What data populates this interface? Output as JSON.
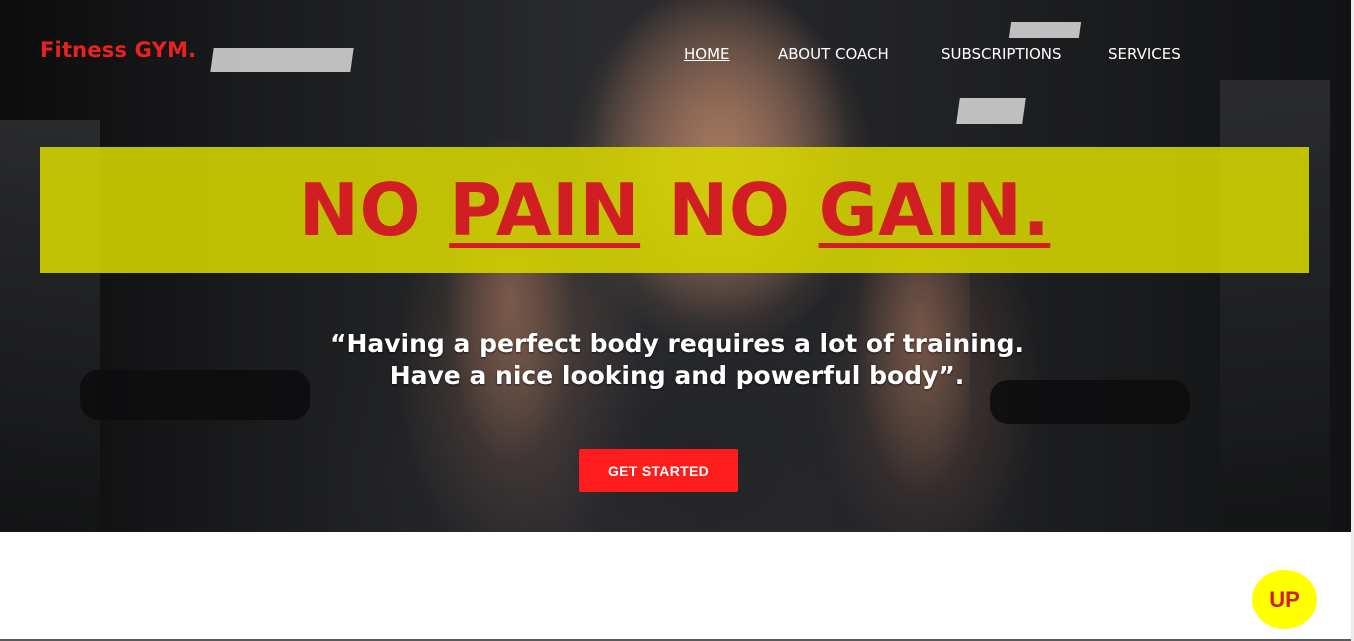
{
  "brand": {
    "logo_text": "Fitness GYM."
  },
  "nav": {
    "items": [
      {
        "label": "HOME",
        "active": true
      },
      {
        "label": "ABOUT COACH",
        "active": false
      },
      {
        "label": "SUBSCRIPTIONS",
        "active": false
      },
      {
        "label": "SERVICES",
        "active": false
      }
    ]
  },
  "hero": {
    "headline": {
      "word1": "NO",
      "word2": "PAIN",
      "word3": "NO",
      "word4": "GAIN."
    },
    "quote_line1": "“Having a perfect body requires a lot of training.",
    "quote_line2": "Have a nice looking and powerful body”.",
    "cta_label": "GET STARTED",
    "background_icon": "gym-athlete-photo"
  },
  "scroll_top": {
    "label": "UP"
  },
  "colors": {
    "brand_red": "#e8231f",
    "banner_yellow": "#d6d600",
    "headline_red": "#d11e23",
    "cta_red": "#ff1c1c",
    "up_yellow": "#ffff00"
  }
}
